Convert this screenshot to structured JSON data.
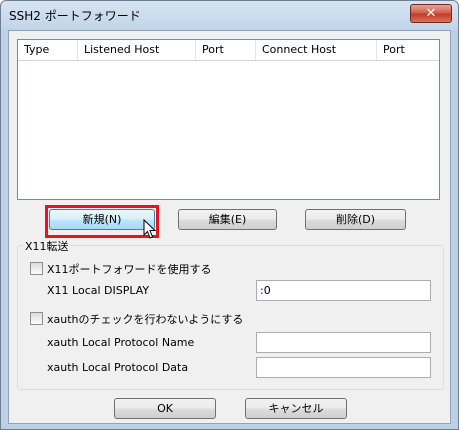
{
  "window": {
    "title": "SSH2 ポートフォワード",
    "close_label": "✕"
  },
  "list": {
    "columns": [
      "Type",
      "Listened Host",
      "Port",
      "Connect Host",
      "Port"
    ]
  },
  "buttons": {
    "new": "新規(N)",
    "edit": "編集(E)",
    "delete": "削除(D)",
    "ok": "OK",
    "cancel": "キャンセル"
  },
  "x11": {
    "group_label": "X11転送",
    "enable_label": "X11ポートフォワードを使用する",
    "enable_checked": false,
    "display_label": "X11 Local DISPLAY",
    "display_value": ":0",
    "xauth_label": "xauthのチェックを行わないようにする",
    "xauth_checked": false,
    "proto_name_label": "xauth Local Protocol Name",
    "proto_name_value": "",
    "proto_data_label": "xauth Local Protocol Data",
    "proto_data_value": ""
  },
  "colors": {
    "highlight": "#e8141c",
    "close_button": "#c03b27"
  }
}
